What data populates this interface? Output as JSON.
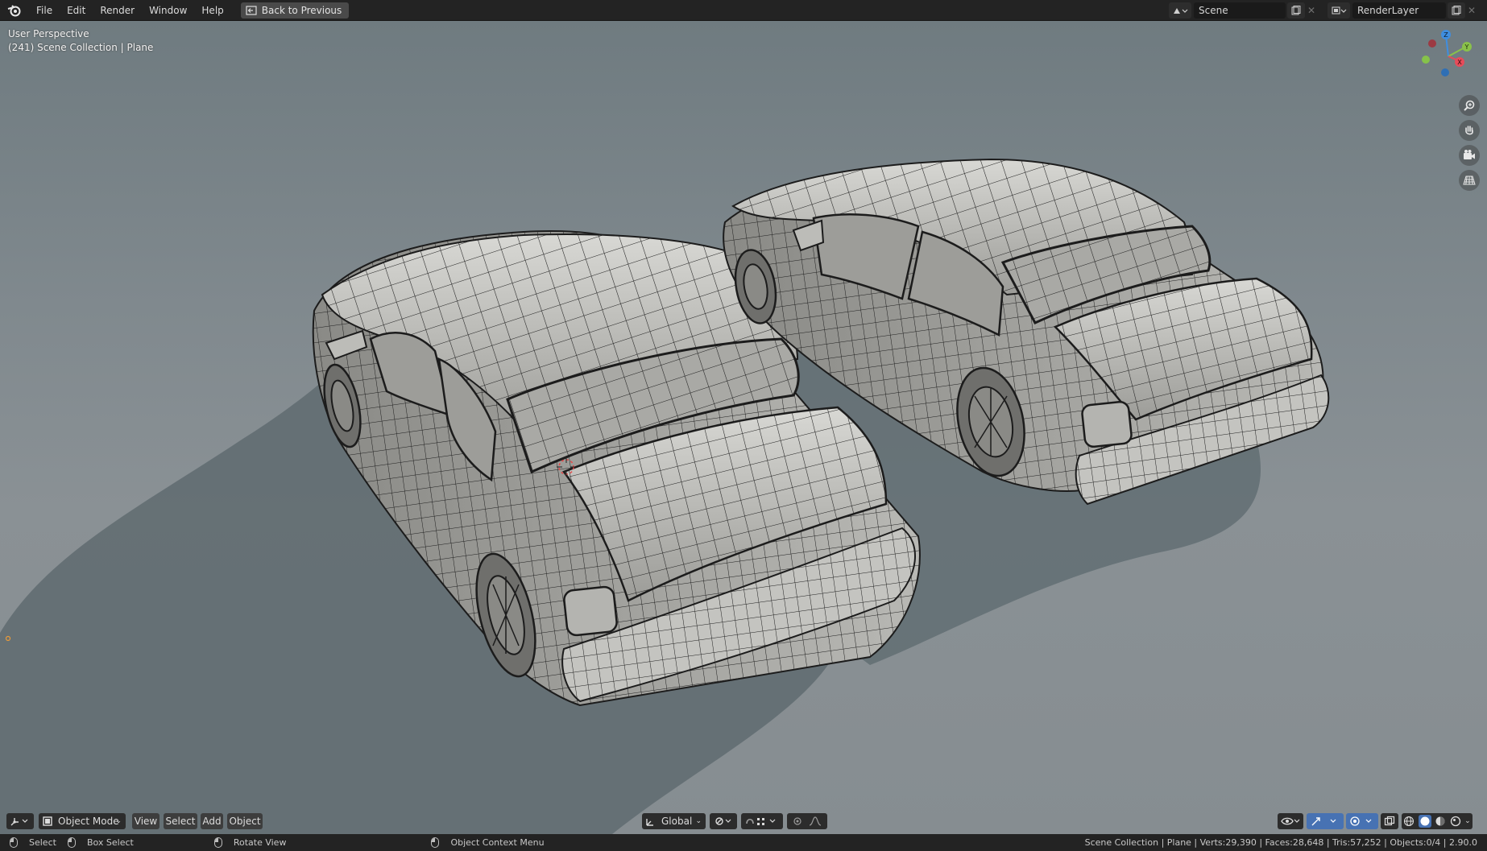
{
  "menu": [
    "File",
    "Edit",
    "Render",
    "Window",
    "Help"
  ],
  "back_button": "Back to Previous",
  "scene_field": "Scene",
  "renderlayer_field": "RenderLayer",
  "viewport": {
    "perspective": "User Perspective",
    "collection": "(241) Scene Collection | Plane"
  },
  "gizmo_axes": {
    "z": "Z",
    "y": "Y",
    "x": "X"
  },
  "header": {
    "mode": "Object Mode",
    "view": "View",
    "select": "Select",
    "add": "Add",
    "object": "Object",
    "orientation": "Global"
  },
  "status": {
    "select": "Select",
    "box_select": "Box Select",
    "rotate_view": "Rotate View",
    "context_menu": "Object Context Menu",
    "stats": "Scene Collection | Plane | Verts:29,390 | Faces:28,648 | Tris:57,252 | Objects:0/4 | 2.90.0"
  },
  "colors": {
    "topbar": "#232323",
    "viewport_bg": "#80898e",
    "axis_x": "#e64c5a",
    "axis_y": "#8ac24a",
    "axis_z": "#3f8ee0"
  },
  "icons": [
    "blender-logo-icon",
    "back-arrow-icon",
    "scene-icon",
    "renderlayer-icon",
    "zoom-icon",
    "hand-pan-icon",
    "camera-icon",
    "grid-perspective-icon",
    "cube-icon",
    "transform-icon",
    "snap-icon",
    "proportional-icon",
    "visibility-icon",
    "gizmo-icon",
    "overlay-icon",
    "xray-icon",
    "wireframe-icon",
    "solid-icon",
    "material-icon",
    "rendered-icon"
  ]
}
